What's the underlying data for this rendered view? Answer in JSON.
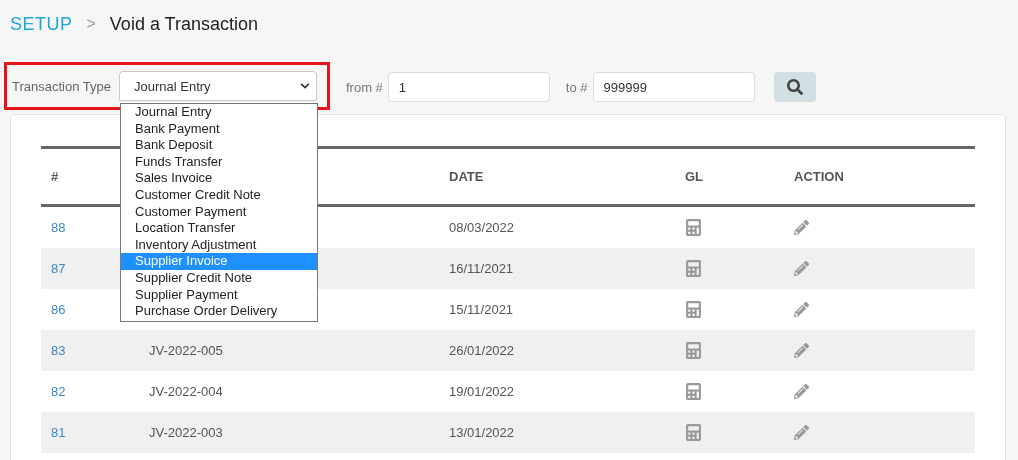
{
  "breadcrumb": {
    "section": "SETUP",
    "separator": ">",
    "title": "Void a Transaction"
  },
  "filter": {
    "label": "Transaction Type",
    "value": "Journal Entry",
    "expanded": true,
    "highlighted": true,
    "options": [
      {
        "label": "Journal Entry",
        "highlighted": false
      },
      {
        "label": "Bank Payment",
        "highlighted": false
      },
      {
        "label": "Bank Deposit",
        "highlighted": false
      },
      {
        "label": "Funds Transfer",
        "highlighted": false
      },
      {
        "label": "Sales Invoice",
        "highlighted": false
      },
      {
        "label": "Customer Credit Note",
        "highlighted": false
      },
      {
        "label": "Customer Payment",
        "highlighted": false
      },
      {
        "label": "Location Transfer",
        "highlighted": false
      },
      {
        "label": "Inventory Adjustment",
        "highlighted": false
      },
      {
        "label": "Supplier Invoice",
        "highlighted": true
      },
      {
        "label": "Supplier Credit Note",
        "highlighted": false
      },
      {
        "label": "Supplier Payment",
        "highlighted": false
      },
      {
        "label": "Purchase Order Delivery",
        "highlighted": false
      }
    ],
    "from_label": "from #",
    "from_value": "1",
    "to_label": "to #",
    "to_value": "999999"
  },
  "table": {
    "columns": [
      "#",
      "DATE",
      "GL",
      "ACTION"
    ],
    "rows": [
      {
        "number": "88",
        "date": "08/03/2022"
      },
      {
        "number": "87",
        "date": "16/11/2021"
      },
      {
        "number": "86",
        "date": "15/11/2021"
      },
      {
        "number": "83",
        "reference": "JV-2022-005",
        "date": "26/01/2022"
      },
      {
        "number": "82",
        "reference": "JV-2022-004",
        "date": "19/01/2022"
      },
      {
        "number": "81",
        "reference": "JV-2022-003",
        "date": "13/01/2022"
      }
    ]
  }
}
